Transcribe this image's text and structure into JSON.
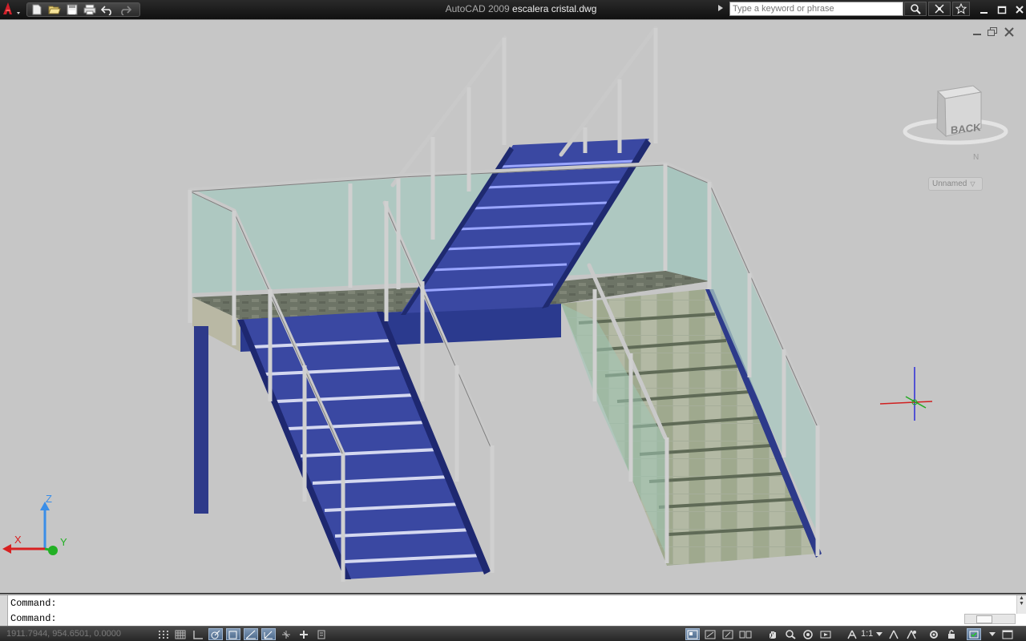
{
  "titlebar": {
    "app_name": "AutoCAD 2009",
    "document_name": "escalera cristal.dwg",
    "search_placeholder": "Type a keyword or phrase"
  },
  "viewport": {
    "viewcube_face": "BACK",
    "viewcube_compass_letter": "N",
    "ucs_name": "Unnamed",
    "axis_labels": {
      "x": "X",
      "y": "Y",
      "z": "Z"
    }
  },
  "command_window": {
    "lines": [
      "Command:",
      "Command:"
    ]
  },
  "statusbar": {
    "coordinates": "1911.7944, 954.6501, 0.0000",
    "annotation_scale": "1:1"
  },
  "colors": {
    "background": "#c6c6c6",
    "steel": "#2e3a8a",
    "glass": "#a9c8c0",
    "rail": "#c8c8c8",
    "stone": "#a7b09a"
  },
  "icons": [
    "autocad-logo-icon",
    "new-icon",
    "open-icon",
    "save-icon",
    "plot-icon",
    "undo-icon",
    "redo-icon",
    "search-icon",
    "communication-icon",
    "favorites-icon",
    "minimize-icon",
    "maximize-icon",
    "close-icon"
  ]
}
